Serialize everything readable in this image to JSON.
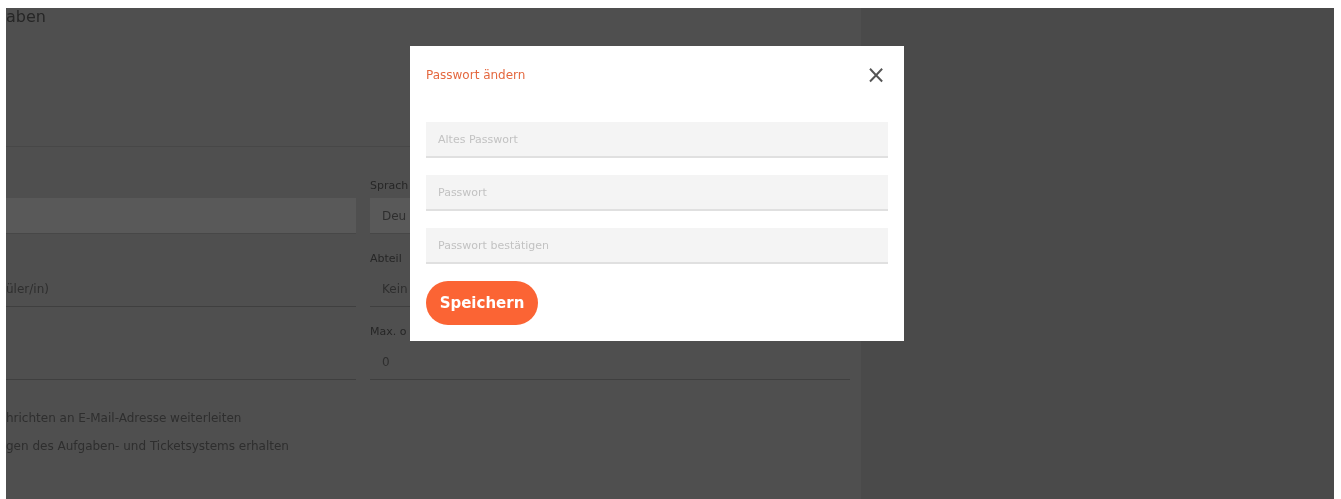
{
  "page": {
    "heading": "aben",
    "left_fields": [
      {
        "kind": "filled"
      },
      {
        "kind": "line",
        "value": "üler/in)"
      },
      {
        "kind": "line"
      }
    ],
    "right_fields": [
      {
        "label": "Sprach",
        "value": "Deu",
        "kind": "filled"
      },
      {
        "label": "Abteil",
        "value": "Kein",
        "kind": "line"
      },
      {
        "label": "Max. o",
        "value": "0",
        "kind": "line"
      }
    ],
    "options": [
      "hrichten an E-Mail-Adresse weiterleiten",
      "gen des Aufgaben- und Ticketsystems erhalten"
    ]
  },
  "dialog": {
    "title": "Passwort ändern",
    "close": "×",
    "fields": [
      {
        "placeholder": "Altes Passwort"
      },
      {
        "placeholder": "Passwort"
      },
      {
        "placeholder": "Passwort bestätigen"
      }
    ],
    "button": "Speichern"
  }
}
